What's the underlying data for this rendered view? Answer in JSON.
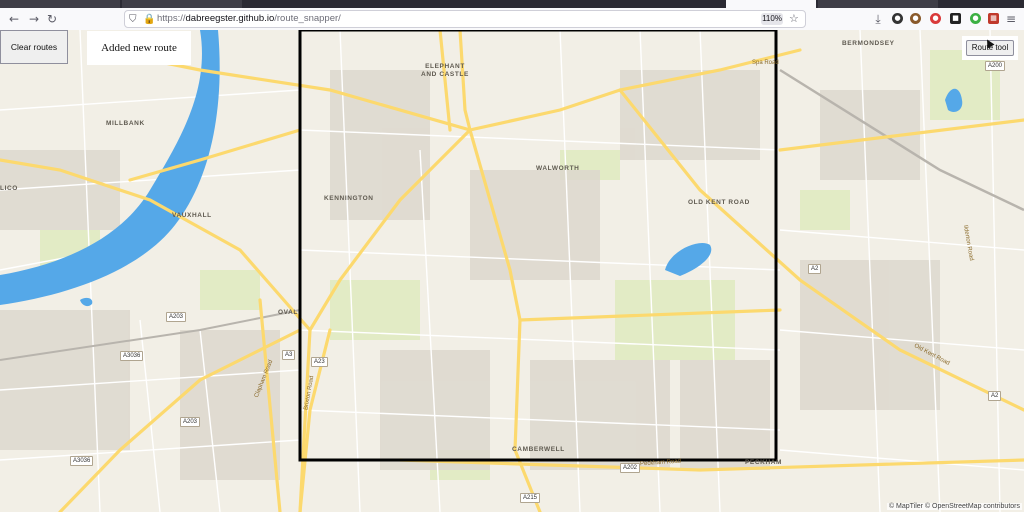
{
  "browser": {
    "url_prefix": "https://",
    "url_host": "dabreegster.github.io",
    "url_path": "/route_snapper/",
    "zoom": "110%"
  },
  "toolbar": {
    "clear_routes_label": "Clear routes",
    "status_text": "Added new route",
    "route_tool_label": "Route tool"
  },
  "map_labels": {
    "elephant_castle": "ELEPHANT AND CASTLE",
    "millbank": "MILLBANK",
    "kennington": "KENNINGTON",
    "walworth": "WALWORTH",
    "old_kent_road": "OLD KENT ROAD",
    "vauxhall": "VAUXHALL",
    "oval": "OVAL",
    "camberwell": "CAMBERWELL",
    "peckham": "PECKHAM",
    "bermondsey": "BERMONDSEY",
    "lico": "LICO"
  },
  "road_labels": {
    "spa_road": "Spa Road",
    "old_kent_road_street": "Old Kent Road",
    "peckham_road": "Peckham Road",
    "brixton_road": "Brixton Road",
    "clapham_road": "Clapham Road",
    "rotherhithe": "Ilderton Road"
  },
  "shields": {
    "a203_1": "A203",
    "a3036_1": "A3036",
    "a3": "A3",
    "a23": "A23",
    "a203_2": "A203",
    "a3036_2": "A3036",
    "a2_1": "A2",
    "a2_2": "A2",
    "a200": "A200",
    "a202": "A202",
    "a215": "A215"
  },
  "attribution": "© MapTiler © OpenStreetMap contributors",
  "colors": {
    "water": "#55a8e8",
    "major_road": "#fcd96e",
    "land": "#f2efe6",
    "park": "#e2ebc5",
    "building": "#ddd8ce",
    "boundary": "#000000"
  }
}
